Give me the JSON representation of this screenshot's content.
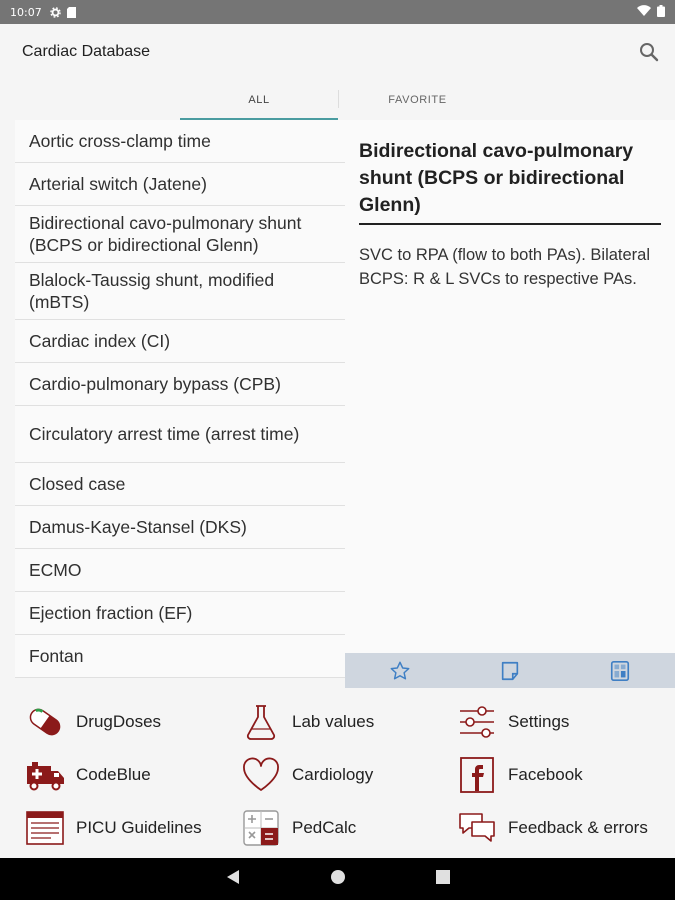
{
  "status_bar": {
    "time": "10:07"
  },
  "app_bar": {
    "title": "Cardiac Database"
  },
  "tabs": [
    {
      "label": "ALL"
    },
    {
      "label": "FAVORITE"
    }
  ],
  "list": {
    "items": [
      {
        "label": "Aortic cross-clamp time"
      },
      {
        "label": "Arterial switch (Jatene)"
      },
      {
        "label": "Bidirectional cavo-pulmonary shunt (BCPS or bidirectional Glenn)"
      },
      {
        "label": "Blalock-Taussig shunt, modified (mBTS)"
      },
      {
        "label": "Cardiac index (CI)"
      },
      {
        "label": "Cardio-pulmonary bypass (CPB)"
      },
      {
        "label": "Circulatory arrest time (arrest time)"
      },
      {
        "label": "Closed case"
      },
      {
        "label": "Damus-Kaye-Stansel (DKS)"
      },
      {
        "label": "ECMO"
      },
      {
        "label": "Ejection fraction (EF)"
      },
      {
        "label": "Fontan"
      }
    ]
  },
  "detail": {
    "title": "Bidirectional cavo-pulmonary shunt (BCPS or bidirectional Glenn)",
    "body": "SVC to RPA (flow to both PAs). Bilateral BCPS: R & L SVCs to respective PAs."
  },
  "detail_toolbar": {
    "icons": [
      "star-icon",
      "note-icon",
      "calculator-icon"
    ]
  },
  "bottom_menu": {
    "items": [
      {
        "label": "DrugDoses",
        "icon": "pill-icon"
      },
      {
        "label": "Lab values",
        "icon": "flask-icon"
      },
      {
        "label": "Settings",
        "icon": "sliders-icon"
      },
      {
        "label": "CodeBlue",
        "icon": "ambulance-icon"
      },
      {
        "label": "Cardiology",
        "icon": "heart-icon"
      },
      {
        "label": "Facebook",
        "icon": "facebook-icon"
      },
      {
        "label": "PICU Guidelines",
        "icon": "guidelines-icon"
      },
      {
        "label": "PedCalc",
        "icon": "calculator-icon"
      },
      {
        "label": "Feedback & errors",
        "icon": "chat-icon"
      }
    ],
    "accent_color": "#8b1a1a"
  },
  "colors": {
    "tab_indicator": "#4a9ca0",
    "toolbar_bg": "#cfd6df",
    "status_bar": "#757575"
  }
}
